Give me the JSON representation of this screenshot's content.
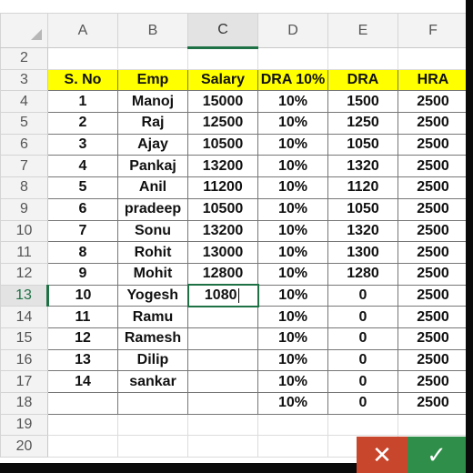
{
  "columns": [
    "A",
    "B",
    "C",
    "D",
    "E",
    "F"
  ],
  "selected_column": "C",
  "rows": [
    {
      "row": "2",
      "cells": [
        "",
        "",
        "",
        "",
        "",
        ""
      ],
      "kind": "empty"
    },
    {
      "row": "3",
      "cells": [
        "S. No",
        "Emp",
        "Salary",
        "DRA 10%",
        "DRA",
        "HRA"
      ],
      "kind": "header"
    },
    {
      "row": "4",
      "cells": [
        "1",
        "Manoj",
        "15000",
        "10%",
        "1500",
        "2500"
      ],
      "kind": "data"
    },
    {
      "row": "5",
      "cells": [
        "2",
        "Raj",
        "12500",
        "10%",
        "1250",
        "2500"
      ],
      "kind": "data"
    },
    {
      "row": "6",
      "cells": [
        "3",
        "Ajay",
        "10500",
        "10%",
        "1050",
        "2500"
      ],
      "kind": "data"
    },
    {
      "row": "7",
      "cells": [
        "4",
        "Pankaj",
        "13200",
        "10%",
        "1320",
        "2500"
      ],
      "kind": "data"
    },
    {
      "row": "8",
      "cells": [
        "5",
        "Anil",
        "11200",
        "10%",
        "1120",
        "2500"
      ],
      "kind": "data"
    },
    {
      "row": "9",
      "cells": [
        "6",
        "pradeep",
        "10500",
        "10%",
        "1050",
        "2500"
      ],
      "kind": "data"
    },
    {
      "row": "10",
      "cells": [
        "7",
        "Sonu",
        "13200",
        "10%",
        "1320",
        "2500"
      ],
      "kind": "data"
    },
    {
      "row": "11",
      "cells": [
        "8",
        "Rohit",
        "13000",
        "10%",
        "1300",
        "2500"
      ],
      "kind": "data"
    },
    {
      "row": "12",
      "cells": [
        "9",
        "Mohit",
        "12800",
        "10%",
        "1280",
        "2500"
      ],
      "kind": "data"
    },
    {
      "row": "13",
      "cells": [
        "10",
        "Yogesh",
        "1080",
        "10%",
        "0",
        "2500"
      ],
      "kind": "data",
      "active_col": 2
    },
    {
      "row": "14",
      "cells": [
        "11",
        "Ramu",
        "",
        "10%",
        "0",
        "2500"
      ],
      "kind": "data"
    },
    {
      "row": "15",
      "cells": [
        "12",
        "Ramesh",
        "",
        "10%",
        "0",
        "2500"
      ],
      "kind": "data"
    },
    {
      "row": "16",
      "cells": [
        "13",
        "Dilip",
        "",
        "10%",
        "0",
        "2500"
      ],
      "kind": "data"
    },
    {
      "row": "17",
      "cells": [
        "14",
        "sankar",
        "",
        "10%",
        "0",
        "2500"
      ],
      "kind": "data"
    },
    {
      "row": "18",
      "cells": [
        "",
        "",
        "",
        "10%",
        "0",
        "2500"
      ],
      "kind": "data"
    },
    {
      "row": "19",
      "cells": [
        "",
        "",
        "",
        "",
        "",
        ""
      ],
      "kind": "empty"
    },
    {
      "row": "20",
      "cells": [
        "",
        "",
        "",
        "",
        "",
        ""
      ],
      "kind": "empty"
    }
  ],
  "selected_row": "13",
  "buttons": {
    "cancel_icon": "close-icon",
    "cancel_glyph": "✕",
    "confirm_icon": "check-icon",
    "confirm_glyph": "✓"
  },
  "colors": {
    "header_fill": "#ffff00",
    "selection": "#1e7145",
    "cancel": "#c8462c",
    "confirm": "#2f8f4a"
  }
}
